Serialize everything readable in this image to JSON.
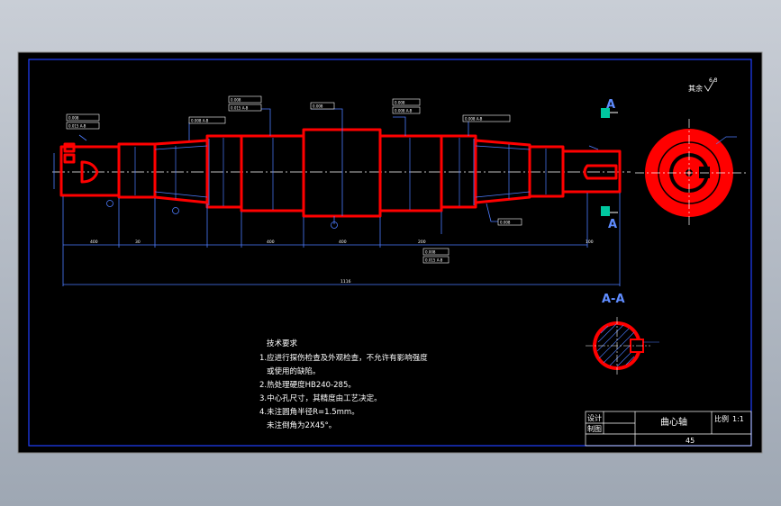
{
  "view": {
    "background": "#000000",
    "frame_color": "#2040ff",
    "part_color": "#ff0000",
    "dim_color": "#4d7cff",
    "section_marker_color": "#00c8a0"
  },
  "markers": {
    "section_top": "A",
    "section_bottom": "A",
    "section_title": "A-A",
    "surface_finish": "其余",
    "surface_value": "6.3"
  },
  "technical_requirements": {
    "heading": "技术要求",
    "items": [
      "1.应进行探伤检查及外观检查，不允许有影响强度",
      "  或使用的缺陷。",
      "2.热处理硬度HB240-285。",
      "3.中心孔尺寸，其精度由工艺决定。",
      "4.未注圆角半径R=1.5mm。",
      "  未注倒角为2X45°。"
    ]
  },
  "title_block": {
    "designer_label": "设计",
    "checker_label": "制图",
    "part_name": "曲心轴",
    "scale_label": "比例",
    "scale_value": "1:1",
    "material": "45"
  },
  "dimensions": {
    "overall_length": "1116",
    "seg_1": "400",
    "seg_2": "30",
    "seg_3": "400",
    "seg_4": "400",
    "seg_5": "200",
    "seg_6": "100"
  },
  "tolerance_frames": [
    {
      "rows": [
        "0.008",
        "0.015 A-B"
      ]
    },
    {
      "rows": [
        "0.008",
        "0.015 A-B"
      ]
    },
    {
      "rows": [
        "0.008 A-B"
      ]
    },
    {
      "rows": [
        "0.008"
      ]
    },
    {
      "rows": [
        "0.008",
        "0.008 A-B"
      ]
    },
    {
      "rows": [
        "0.008 A-B"
      ]
    },
    {
      "rows": [
        "0.008"
      ]
    },
    {
      "rows": [
        "0.008",
        "0.015 A-B"
      ]
    }
  ]
}
